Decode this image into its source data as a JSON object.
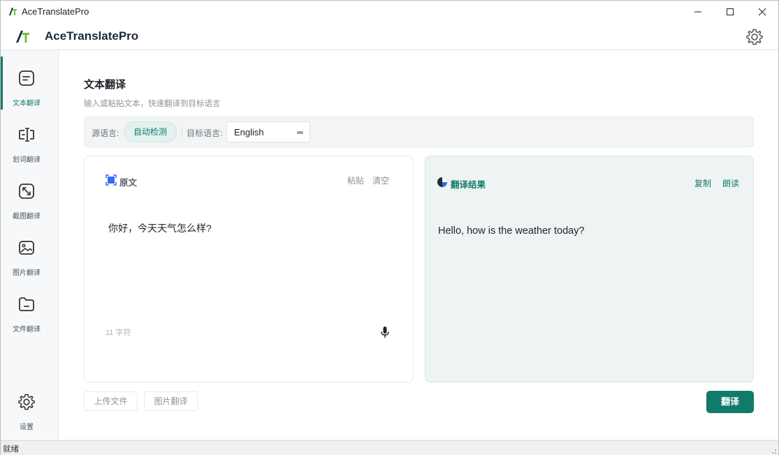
{
  "window": {
    "title": "AceTranslatePro"
  },
  "header": {
    "brand": "AceTranslatePro"
  },
  "sidebar": {
    "items": [
      {
        "label": "文本翻译",
        "icon": "text-doc-icon",
        "active": true
      },
      {
        "label": "划词翻译",
        "icon": "text-cursor-icon",
        "active": false
      },
      {
        "label": "截图翻译",
        "icon": "screenshot-expand-icon",
        "active": false
      },
      {
        "label": "图片翻译",
        "icon": "image-icon",
        "active": false
      },
      {
        "label": "文件翻译",
        "icon": "folder-icon",
        "active": false
      }
    ],
    "settings_label": "设置"
  },
  "main": {
    "title": "文本翻译",
    "subtitle": "输入或粘贴文本，快速翻译到目标语言",
    "lang": {
      "source_label": "源语言:",
      "source_value": "自动检测",
      "target_label": "目标语言:",
      "target_value": "English"
    },
    "source": {
      "title": "原文",
      "paste": "粘贴",
      "clear": "清空",
      "text": "你好，今天天气怎么样?",
      "count": "11 字符"
    },
    "result": {
      "title": "翻译结果",
      "copy": "复制",
      "read": "朗读",
      "text": "Hello, how is the weather today?"
    },
    "buttons": {
      "upload": "上传文件",
      "image": "图片翻译",
      "translate": "翻译"
    }
  },
  "status": {
    "text": "就绪"
  },
  "colors": {
    "accent": "#127a6b",
    "result_bg": "#eef4f3"
  }
}
